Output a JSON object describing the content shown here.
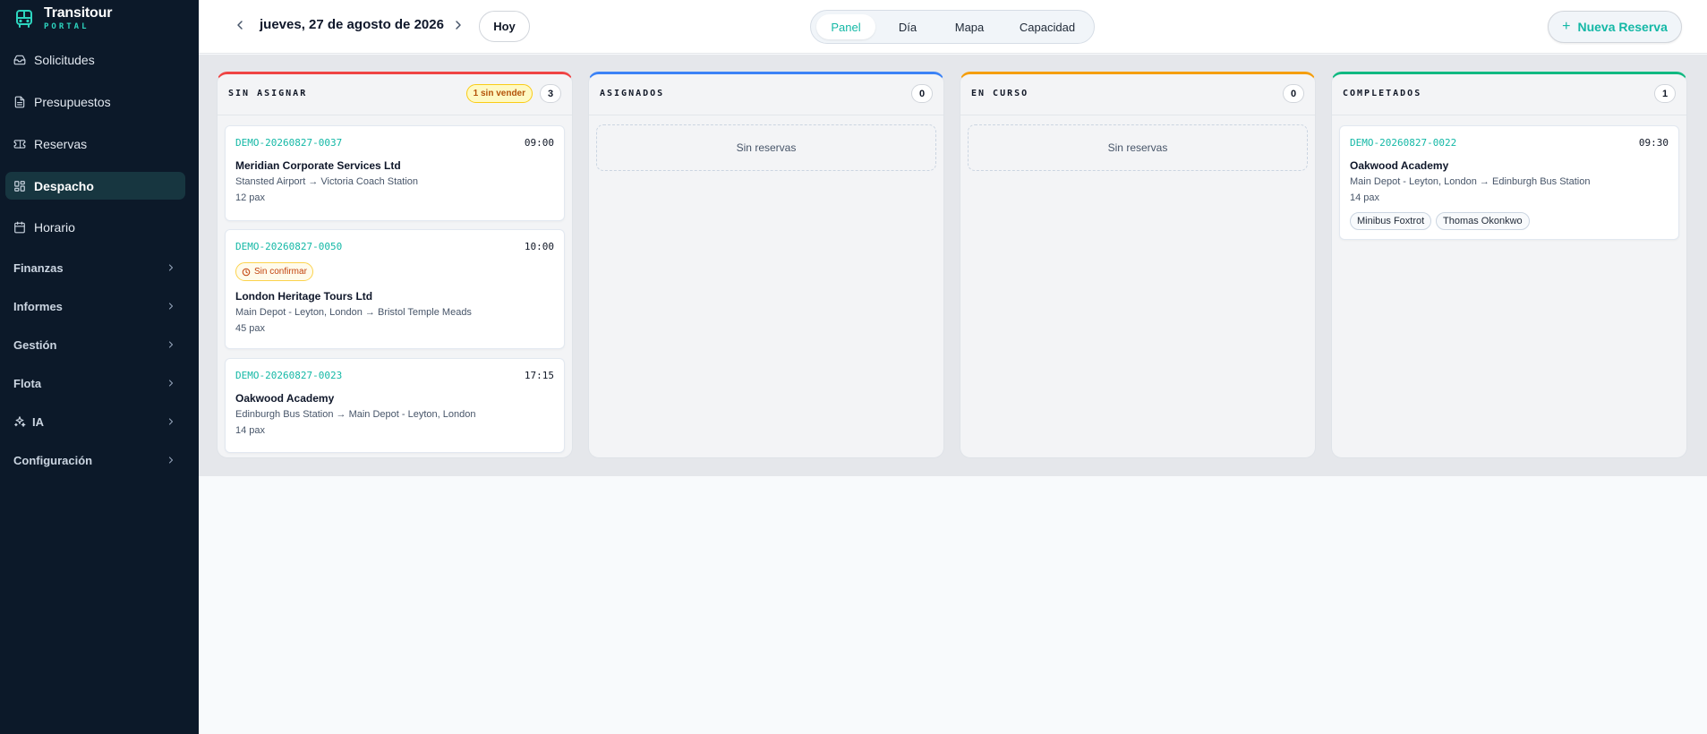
{
  "brand": {
    "name": "Transitour",
    "sub": "PORTAL"
  },
  "sidebar": {
    "items": [
      {
        "label": "Solicitudes",
        "icon": "inbox-icon"
      },
      {
        "label": "Presupuestos",
        "icon": "document-icon"
      },
      {
        "label": "Reservas",
        "icon": "ticket-icon"
      },
      {
        "label": "Despacho",
        "icon": "dashboard-icon",
        "active": true
      },
      {
        "label": "Horario",
        "icon": "calendar-icon"
      }
    ],
    "groups": [
      {
        "label": "Finanzas"
      },
      {
        "label": "Informes"
      },
      {
        "label": "Gestión"
      },
      {
        "label": "Flota"
      },
      {
        "label": "IA",
        "icon": "sparkles-icon"
      },
      {
        "label": "Configuración"
      }
    ]
  },
  "topbar": {
    "date": "jueves, 27 de agosto de 2026",
    "today": "Hoy",
    "tabs": [
      "Panel",
      "Día",
      "Mapa",
      "Capacidad"
    ],
    "active_tab": "Panel",
    "new_booking": "Nueva Reserva"
  },
  "columns": [
    {
      "title": "SIN ASIGNAR",
      "count": "3",
      "color": "#ef4444",
      "badge": "1 sin vender",
      "cards": [
        {
          "ref": "DEMO-20260827-0037",
          "time": "09:00",
          "client": "Meridian Corporate Services Ltd",
          "route": "Stansted Airport → Victoria Coach Station",
          "pax": "12 pax"
        },
        {
          "ref": "DEMO-20260827-0050",
          "time": "10:00",
          "status": "Sin confirmar",
          "client": "London Heritage Tours Ltd",
          "route": "Main Depot - Leyton, London → Bristol Temple Meads",
          "pax": "45 pax"
        },
        {
          "ref": "DEMO-20260827-0023",
          "time": "17:15",
          "client": "Oakwood Academy",
          "route": "Edinburgh Bus Station → Main Depot - Leyton, London",
          "pax": "14 pax"
        }
      ]
    },
    {
      "title": "ASIGNADOS",
      "count": "0",
      "color": "#3b82f6",
      "empty": "Sin reservas"
    },
    {
      "title": "EN CURSO",
      "count": "0",
      "color": "#f59e0b",
      "empty": "Sin reservas"
    },
    {
      "title": "COMPLETADOS",
      "count": "1",
      "color": "#10b981",
      "cards": [
        {
          "ref": "DEMO-20260827-0022",
          "time": "09:30",
          "client": "Oakwood Academy",
          "route": "Main Depot - Leyton, London → Edinburgh Bus Station",
          "pax": "14 pax",
          "vehicle": "Minibus Foxtrot",
          "driver": "Thomas Okonkwo"
        }
      ]
    }
  ]
}
